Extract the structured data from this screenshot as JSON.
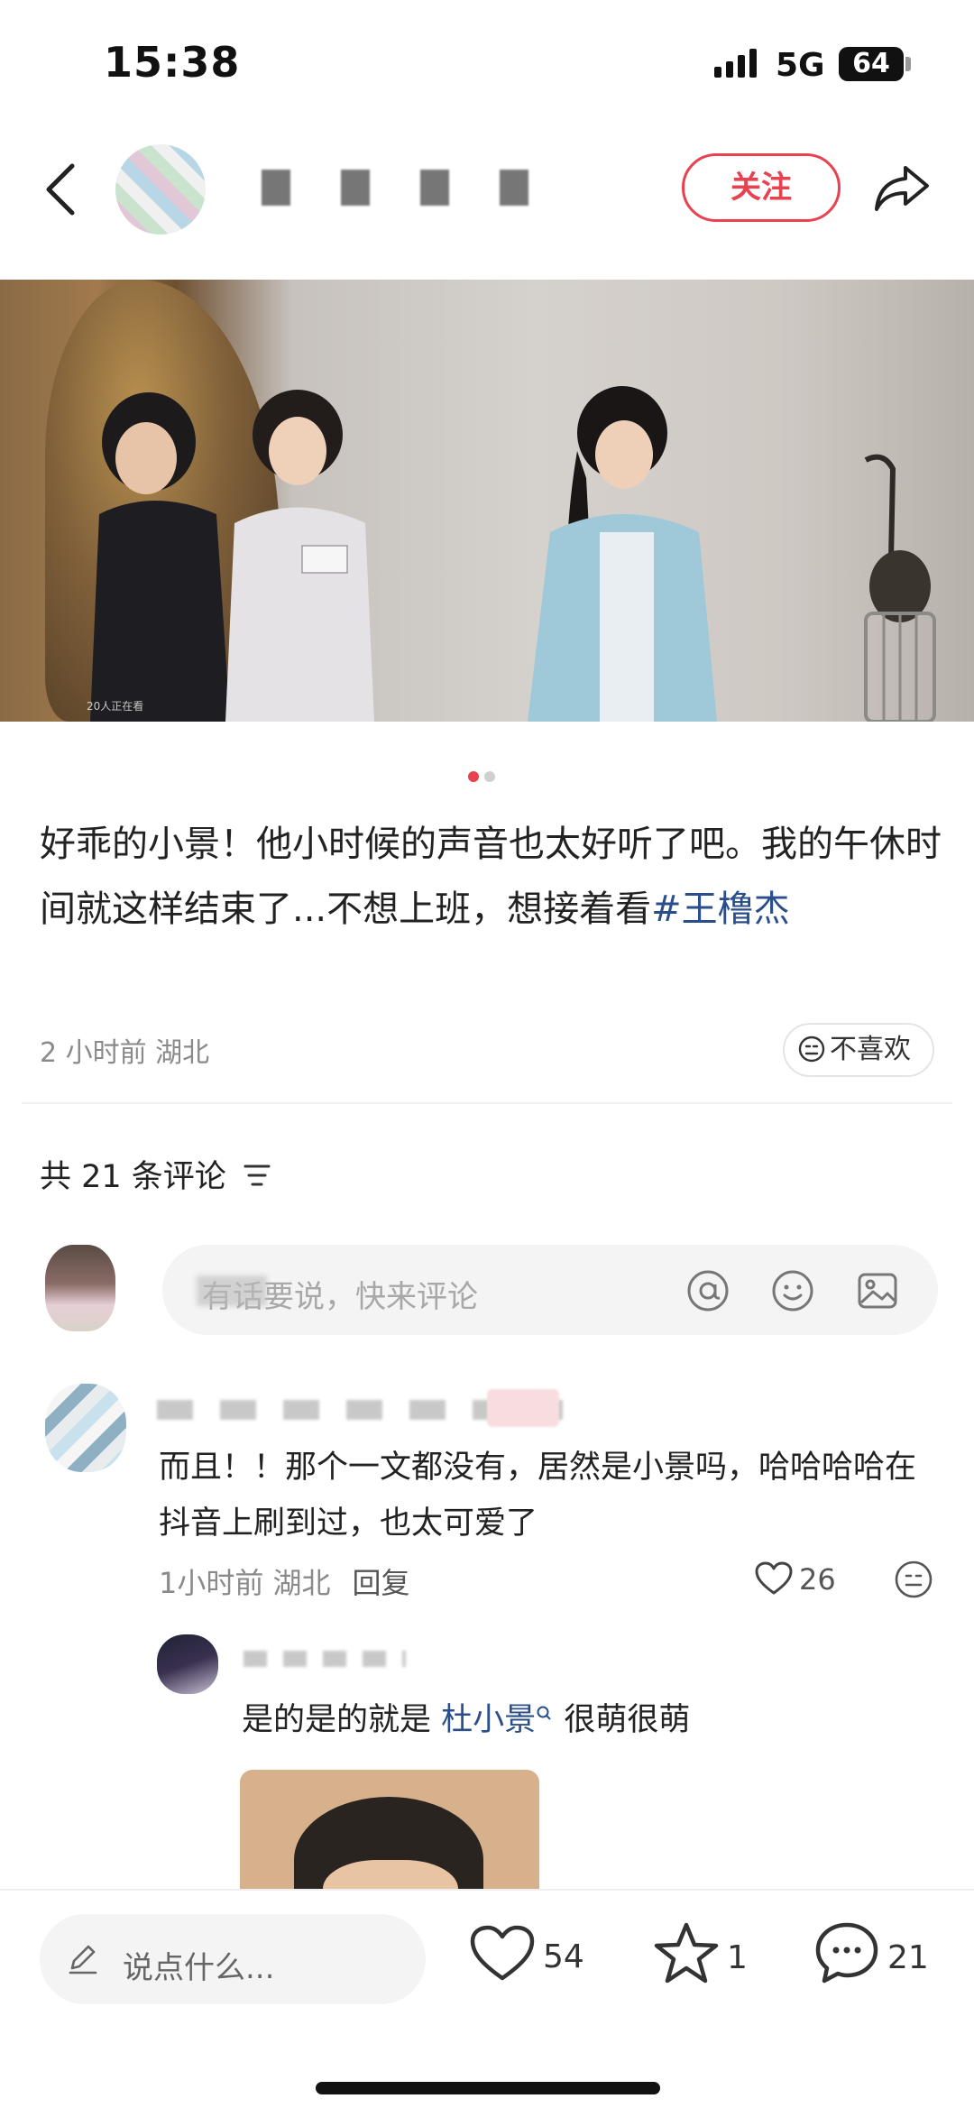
{
  "status_bar": {
    "time": "15:38",
    "network": "5G",
    "battery": "64"
  },
  "header": {
    "follow_label": "关注"
  },
  "post": {
    "text": "好乖的小景！他小时候的声音也太好听了吧。我的午休时间就这样结束了...不想上班，想接着看",
    "hashtag": "#王橹杰",
    "meta": "2 小时前 湖北",
    "dislike_label": "不喜欢",
    "media_watermark": "20人正在看",
    "pager_total": 2,
    "pager_active": 1
  },
  "comments_section": {
    "count_label": "共 21 条评论",
    "input_placeholder": "有话要说，快来评论"
  },
  "comments": [
    {
      "text": "而且！！那个一文都没有，居然是小景吗，哈哈哈哈在抖音上刷到过，也太可爱了",
      "time_location": "1小时前 湖北",
      "reply_label": "回复",
      "likes": "26"
    }
  ],
  "reply": {
    "prefix": "是的是的就是",
    "mention": "杜小景",
    "suffix": "很萌很萌"
  },
  "bottom_bar": {
    "say_placeholder": "说点什么...",
    "likes": "54",
    "stars": "1",
    "comments": "21"
  },
  "colors": {
    "accent": "#e8414f",
    "link": "#2a4e8a"
  },
  "icons": [
    "back-icon",
    "share-icon",
    "sort-icon",
    "at-icon",
    "emoji-icon",
    "image-icon",
    "heart-icon",
    "more-icon",
    "pencil-icon",
    "star-icon",
    "comment-bubble-icon",
    "neutral-face-icon"
  ]
}
